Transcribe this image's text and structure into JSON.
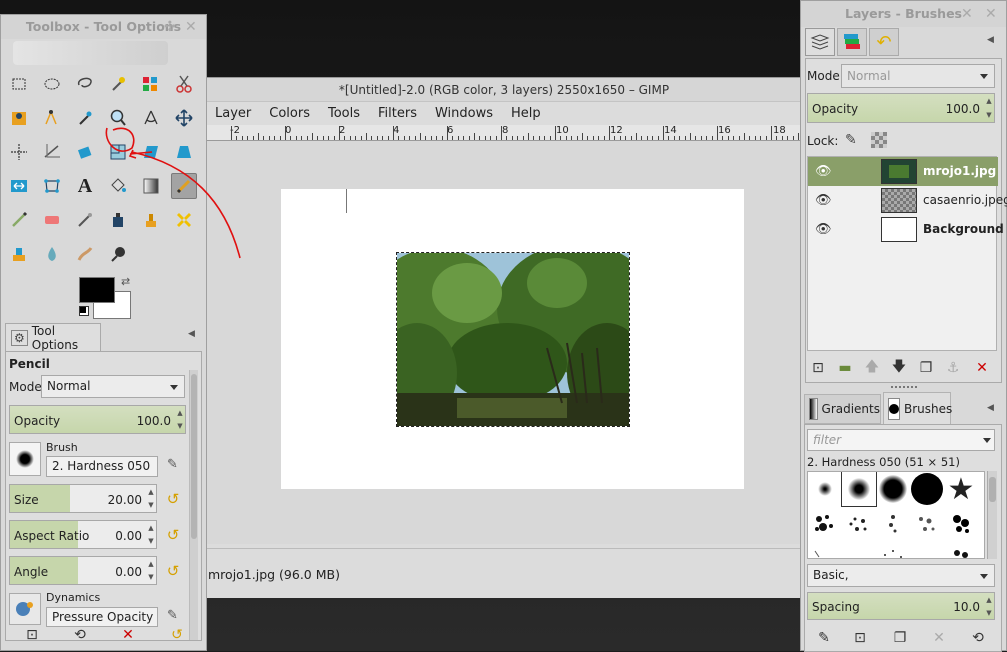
{
  "main_window": {
    "title": "*[Untitled]-2.0 (RGB color, 3 layers) 2550x1650 – GIMP",
    "menus": [
      "Layer",
      "Colors",
      "Tools",
      "Filters",
      "Windows",
      "Help"
    ],
    "ruler_labels": [
      "-2",
      "0",
      "2",
      "4",
      "6",
      "8",
      "10",
      "12",
      "14",
      "16",
      "18"
    ],
    "status_text": "mrojo1.jpg (96.0 MB)"
  },
  "toolbox": {
    "title": "Toolbox - Tool Options",
    "tool_options_tab": "Tool Options",
    "tool_name": "Pencil",
    "mode_label": "Mode:",
    "mode_value": "Normal",
    "opacity_label": "Opacity",
    "opacity_value": "100.0",
    "brush_label": "Brush",
    "brush_value": "2. Hardness 050",
    "size_label": "Size",
    "size_value": "20.00",
    "aspect_label": "Aspect Ratio",
    "aspect_value": "0.00",
    "angle_label": "Angle",
    "angle_value": "0.00",
    "dynamics_label": "Dynamics",
    "dynamics_value": "Pressure Opacity",
    "fg_color": "#000000",
    "bg_color": "#ffffff"
  },
  "layers_panel": {
    "title": "Layers - Brushes",
    "mode_label": "Mode:",
    "mode_value": "Normal",
    "opacity_label": "Opacity",
    "opacity_value": "100.0",
    "lock_label": "Lock:",
    "layers": [
      {
        "name": "mrojo1.jpg",
        "selected": true
      },
      {
        "name": "casaenrio.jpeg",
        "selected": false
      },
      {
        "name": "Background",
        "selected": false
      }
    ]
  },
  "brushes_panel": {
    "tab_gradients": "Gradients",
    "tab_brushes": "Brushes",
    "filter_placeholder": "filter",
    "current_brush": "2. Hardness 050 (51 × 51)",
    "preset_value": "Basic,",
    "spacing_label": "Spacing",
    "spacing_value": "10.0"
  },
  "colors": {
    "accent_green": "#8a9f69",
    "annotation_red": "#e01010"
  }
}
